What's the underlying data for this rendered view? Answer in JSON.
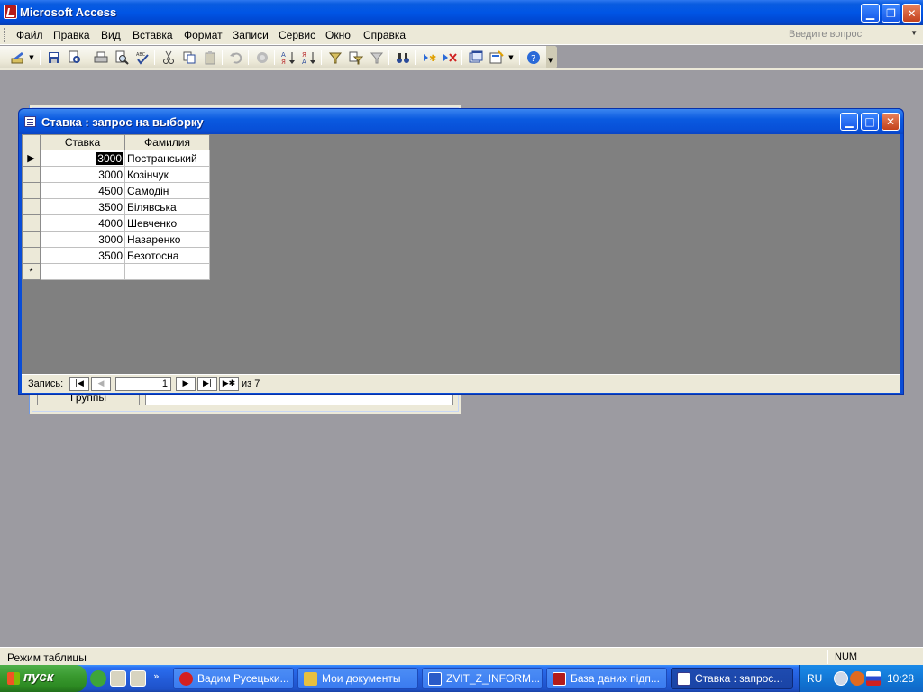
{
  "app": {
    "title": "Microsoft Access"
  },
  "menu": {
    "items": [
      "Файл",
      "Правка",
      "Вид",
      "Вставка",
      "Формат",
      "Записи",
      "Сервис",
      "Окно",
      "Справка"
    ],
    "ask_placeholder": "Введите вопрос"
  },
  "background_form": {
    "label": "Группы"
  },
  "query_window": {
    "title": "Ставка : запрос на выборку",
    "columns": [
      "Ставка",
      "Фамилия"
    ],
    "rows": [
      {
        "rate": "3000",
        "surname": "Постранський"
      },
      {
        "rate": "3000",
        "surname": "Козінчук"
      },
      {
        "rate": "4500",
        "surname": "Самодін"
      },
      {
        "rate": "3500",
        "surname": "Білявська"
      },
      {
        "rate": "4000",
        "surname": "Шевченко"
      },
      {
        "rate": "3000",
        "surname": "Назаренко"
      },
      {
        "rate": "3500",
        "surname": "Безотосна"
      }
    ],
    "new_row_marker": "*",
    "nav": {
      "label": "Запись:",
      "current": "1",
      "of_text": "из  7"
    }
  },
  "status": {
    "text": "Режим таблицы",
    "num": "NUM"
  },
  "taskbar": {
    "start_label": "пуск",
    "tasks": [
      {
        "label": "Вадим Русецьки...",
        "icon_color": "#d42020"
      },
      {
        "label": "Мои документы",
        "icon_color": "#e8c040"
      },
      {
        "label": "ZVIT_Z_INFORM...",
        "icon_color": "#2a5bc8"
      },
      {
        "label": "База даних підп...",
        "icon_color": "#b31b1b"
      },
      {
        "label": "Ставка : запрос...",
        "icon_color": "#ffffff"
      }
    ],
    "lang": "RU",
    "clock": "10:28"
  }
}
